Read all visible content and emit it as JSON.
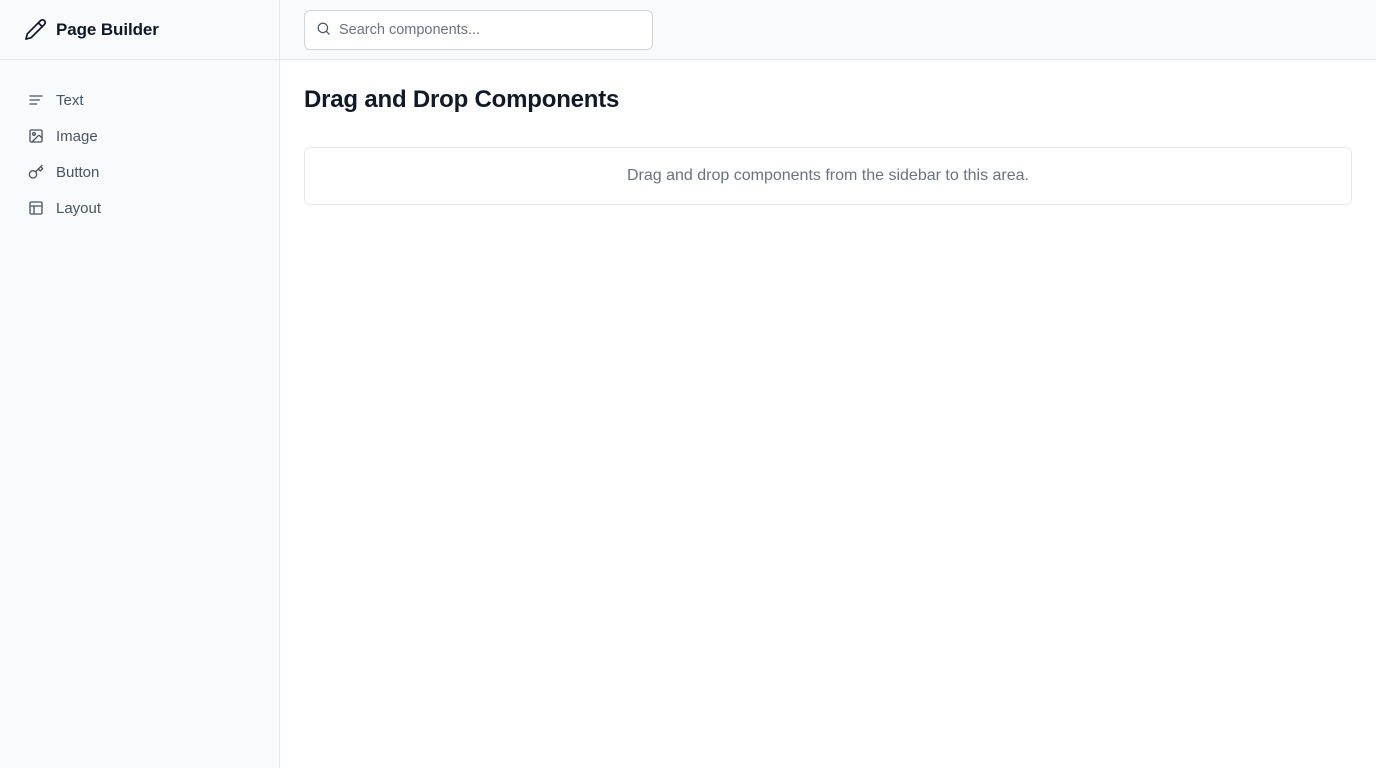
{
  "app": {
    "title": "Page Builder",
    "icon": "pencil-icon"
  },
  "sidebar": {
    "items": [
      {
        "label": "Text",
        "icon": "text-lines-icon"
      },
      {
        "label": "Image",
        "icon": "image-icon"
      },
      {
        "label": "Button",
        "icon": "key-icon"
      },
      {
        "label": "Layout",
        "icon": "layout-icon"
      }
    ]
  },
  "search": {
    "placeholder": "Search components...",
    "value": "",
    "icon": "search-icon"
  },
  "main": {
    "title": "Drag and Drop Components",
    "dropzone_text": "Drag and drop components from the sidebar to this area."
  },
  "colors": {
    "sidebar_bg": "#f9fafb",
    "border": "#e5e7eb",
    "text_primary": "#111827",
    "text_secondary": "#4b5563",
    "text_muted": "#6b7280"
  }
}
